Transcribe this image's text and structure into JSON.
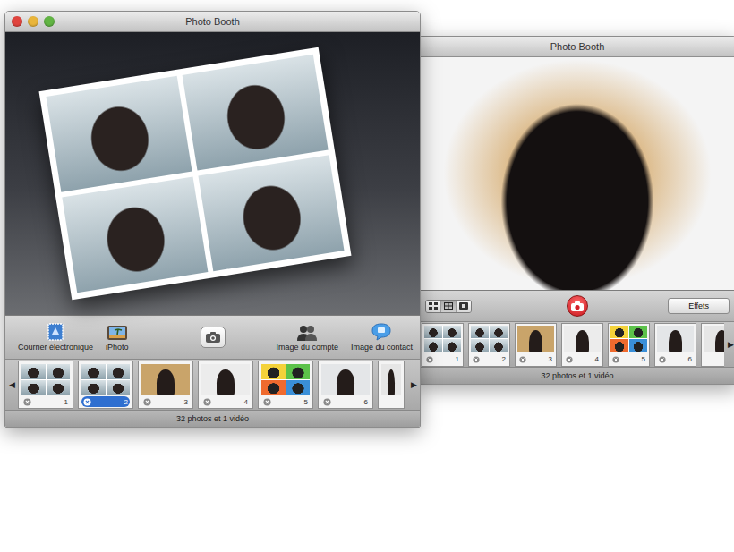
{
  "front_window": {
    "title": "Photo Booth",
    "toolbar": [
      {
        "label": "Courrier électronique",
        "kind": "mail"
      },
      {
        "label": "iPhoto",
        "kind": "iphoto"
      },
      {
        "label": "Image du compte",
        "kind": "account"
      },
      {
        "label": "Image du contact",
        "kind": "contact"
      }
    ],
    "prev": "◀",
    "next": "▶",
    "thumbnails": [
      {
        "number": "1",
        "kind": "grid",
        "selected": false,
        "color": "#9fb3bf"
      },
      {
        "number": "2",
        "kind": "grid",
        "selected": true,
        "color": "#9fb3bf"
      },
      {
        "number": "3",
        "kind": "single",
        "selected": false,
        "color": "#c9a46a"
      },
      {
        "number": "4",
        "kind": "single",
        "selected": false,
        "color": "#ececec"
      },
      {
        "number": "5",
        "kind": "pop",
        "selected": false,
        "color": "#f4d23a"
      },
      {
        "number": "6",
        "kind": "single",
        "selected": false,
        "color": "#e4e6e8"
      }
    ],
    "status": "32 photos et 1 vidéo"
  },
  "back_window": {
    "title": "Photo Booth",
    "view_modes": [
      {
        "kind": "grid",
        "selected": false
      },
      {
        "kind": "quad",
        "selected": true
      },
      {
        "kind": "film",
        "selected": false
      }
    ],
    "effects_button": "Effets",
    "next": "▶",
    "thumbnails": [
      {
        "number": "1",
        "kind": "grid",
        "selected": false,
        "color": "#9fb3bf"
      },
      {
        "number": "2",
        "kind": "grid",
        "selected": false,
        "color": "#9fb3bf"
      },
      {
        "number": "3",
        "kind": "single",
        "selected": false,
        "color": "#c9a46a"
      },
      {
        "number": "4",
        "kind": "single",
        "selected": false,
        "color": "#ececec"
      },
      {
        "number": "5",
        "kind": "pop",
        "selected": false,
        "color": "#f4d23a"
      },
      {
        "number": "6",
        "kind": "single",
        "selected": false,
        "color": "#e4e6e8"
      }
    ],
    "status": "32 photos et 1 vidéo"
  }
}
